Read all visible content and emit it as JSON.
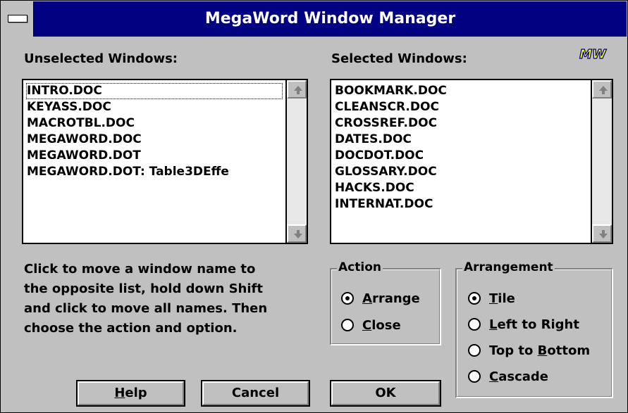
{
  "window": {
    "title": "MegaWord Window Manager"
  },
  "unselected": {
    "label": "Unselected Windows:",
    "items": [
      "INTRO.DOC",
      "KEYASS.DOC",
      "MACROTBL.DOC",
      "MEGAWORD.DOC",
      "MEGAWORD.DOT",
      "MEGAWORD.DOT: Table3DEffe"
    ]
  },
  "selected": {
    "label": "Selected Windows:",
    "items": [
      "BOOKMARK.DOC",
      "CLEANSCR.DOC",
      "CROSSREF.DOC",
      "DATES.DOC",
      "DOCDOT.DOC",
      "GLOSSARY.DOC",
      "HACKS.DOC",
      "INTERNAT.DOC"
    ]
  },
  "logo_text": "MW",
  "help_lines": [
    "Click to move a window name to",
    "the opposite list, hold down Shift",
    "and click to move all names. Then",
    "choose the action and option."
  ],
  "action": {
    "label": "Action",
    "options": [
      {
        "first": "A",
        "rest": "rrange",
        "checked": true
      },
      {
        "first": "C",
        "rest": "lose",
        "checked": false
      }
    ]
  },
  "arrangement": {
    "label": "Arrangement",
    "options": [
      {
        "first": "T",
        "rest": "ile",
        "checked": true
      },
      {
        "first": "L",
        "rest": "eft to Right",
        "checked": false
      },
      {
        "pre": "Top to ",
        "first": "B",
        "rest": "ottom",
        "checked": false
      },
      {
        "first": "C",
        "rest": "ascade",
        "checked": false
      }
    ]
  },
  "buttons": {
    "help_first": "H",
    "help_rest": "elp",
    "cancel": "Cancel",
    "ok": "OK"
  },
  "colors": {
    "titlebar": "#000080",
    "face": "#c0c0c0"
  }
}
